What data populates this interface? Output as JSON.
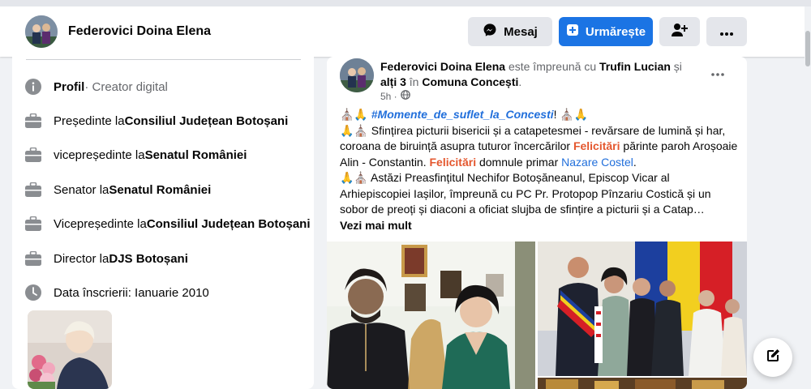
{
  "profile": {
    "name": "Federovici Doina Elena",
    "buttons": {
      "message": "Mesaj",
      "follow": "Urmărește"
    }
  },
  "intro": {
    "items": [
      {
        "prefix": "Profil",
        "suffix": " · Creator digital",
        "org": ""
      },
      {
        "prefix": "",
        "suffix": "Președinte la ",
        "org": "Consiliul Județean Botoșani"
      },
      {
        "prefix": "",
        "suffix": "vicepreședinte la ",
        "org": "Senatul României"
      },
      {
        "prefix": "",
        "suffix": "Senator la ",
        "org": "Senatul României"
      },
      {
        "prefix": "",
        "suffix": "Vicepreședinte la ",
        "org": "Consiliul Județean Botoșani"
      },
      {
        "prefix": "",
        "suffix": "Director la ",
        "org": "DJS Botoșani"
      },
      {
        "prefix": "",
        "suffix": "Data înscrierii: Ianuarie 2010",
        "org": ""
      }
    ]
  },
  "post": {
    "author": "Federovici Doina Elena",
    "with_text": " este împreună cu ",
    "with_person": "Trufin Lucian",
    "and_text": " și ",
    "others": "alți 3",
    "in_text": " în ",
    "place": "Comuna Concești",
    "period": ".",
    "time": "5h ·",
    "emoji_church": "⛪🙏",
    "emoji_church2": "⛪🙏",
    "hashtag": "#Momente_de_suflet_la_Concesti",
    "hashtag_end": "!",
    "emoji_pray": "🙏⛪",
    "line2a": " Sfințirea picturii bisericii și a catapetesmei -  revărsare de lumină și har, coroana de biruință asupra tuturor încercărilor ",
    "felicitari1": "Felicitări",
    "line2b": " părinte paroh Aroșoaie Alin - Constantin. ",
    "felicitari2": "Felicitări",
    "line2c": " domnule primar ",
    "mayor": "Nazare Costel",
    "line2d": ".",
    "emoji_pray2": "🙏⛪",
    "line3": " Astăzi Preasfințitul Nechifor Botoșăneanul, Episcop Vicar al Arhiepiscopiei Iașilor, împreună cu PC Pr. Protopop Pînzariu Costică și un sobor de preoți și diaconi a oficiat slujba de sfințire a picturii și a Catap…",
    "see_more": "Vezi mai mult"
  },
  "icons": {
    "messenger": "messenger-icon",
    "follow": "follow-plus-icon",
    "add_friend": "add-friend-icon",
    "more": "more-dots-icon",
    "info": "info-icon",
    "work": "briefcase-icon",
    "clock": "clock-icon",
    "globe": "globe-icon",
    "compose": "compose-icon"
  },
  "colors": {
    "accent": "#1b74e4",
    "highlight": "#e4572e",
    "link": "#216fdb"
  }
}
